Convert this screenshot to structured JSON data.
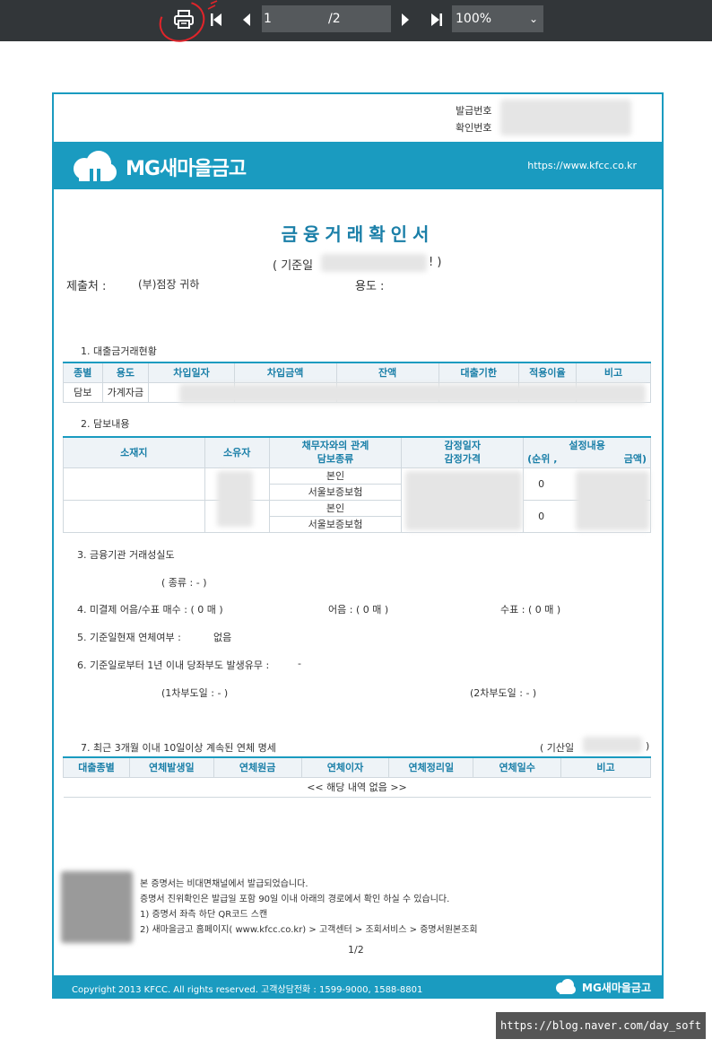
{
  "toolbar": {
    "page_current": "1",
    "page_total": "/2",
    "zoom": "100%"
  },
  "doc": {
    "issue_no_label": "발급번호",
    "confirm_no_label": "확인번호",
    "logo_text": "MG새마을금고",
    "url": "https://www.kfcc.co.kr",
    "title": "금융거래확인서",
    "base_date_open": "( 기준일",
    "base_date_close": "! )",
    "submit_label": "제출처 :",
    "submit_value": "(부)점장 귀하",
    "purpose_label": "용도 :",
    "sec1_title": "1. 대출금거래현황",
    "sec1_headers": [
      "종별",
      "용도",
      "차입일자",
      "차입금액",
      "잔액",
      "대출기한",
      "적용이율",
      "비고"
    ],
    "sec1_row": [
      "담보",
      "가계자금"
    ],
    "sec2_title": "2. 담보내용",
    "sec2_headers": {
      "location": "소재지",
      "owner": "소유자",
      "relation": "채무자와의 관계",
      "collateral_type": "담보종류",
      "appraisal_date": "감정일자",
      "appraisal_price": "감정가격",
      "setting": "설정내용",
      "rank": "(순위 ,",
      "amount": "금액)"
    },
    "sec2_rows": [
      {
        "relation": "본인",
        "type": "서울보증보험",
        "rank": "0"
      },
      {
        "relation": "본인",
        "type": "서울보증보험",
        "rank": "0"
      }
    ],
    "sec3_title": "3. 금융기관 거래성실도",
    "sec3_detail": "( 종류 :       -  )",
    "sec4_title": "4. 미결제 어음/수표 매수 : ( 0 매 )",
    "sec4_bill": "어음 : ( 0 매 )",
    "sec4_check": "수표 : ( 0 매 )",
    "sec5_title": "5. 기준일현재 연체여부 :",
    "sec5_value": "없음",
    "sec6_title": "6. 기준일로부터 1년 이내 당좌부도 발생유무 :",
    "sec6_value": "-",
    "sec6_first": "(1차부도일 : - )",
    "sec6_second": "(2차부도일 : - )",
    "sec7_title": "7. 최근 3개월 이내 10일이상 계속된 연체 명세",
    "sec7_date_open": "( 기산일",
    "sec7_date_close": ")",
    "sec7_headers": [
      "대출종별",
      "연체발생일",
      "연체원금",
      "연체이자",
      "연체정리일",
      "연체일수",
      "비고"
    ],
    "sec7_empty": "<< 해당 내역 없음 >>",
    "notice_lines": [
      "본 증명서는 비대면채널에서 발급되었습니다.",
      "증명서 진위확인은 발급일 포함 90일 이내 아래의 경로에서 확인 하실 수 있습니다.",
      "1) 증명서 좌측 하단 QR코드 스캔",
      "2) 새마을금고 홈페이지( www.kfcc.co.kr) > 고객센터 > 조회서비스 > 증명서원본조회"
    ],
    "page_num": "1/2",
    "copyright": "Copyright 2013 KFCC.  All rights reserved.  고객상담전화 : 1599-9000, 1588-8801",
    "footer_logo": "MG새마을금고"
  },
  "watermark": "https://blog.naver.com/day_soft",
  "colors": {
    "toolbar": "#323639",
    "brand": "#1a9bc0",
    "title": "#1a7fa8",
    "annotation": "#e0242a"
  }
}
